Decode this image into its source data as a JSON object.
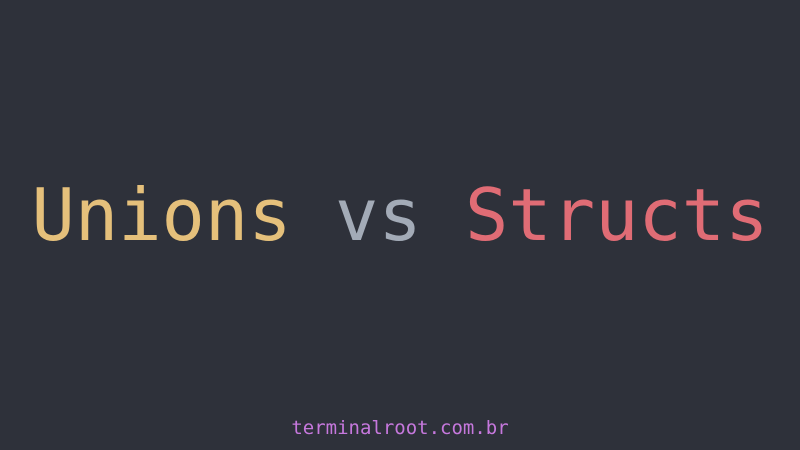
{
  "title": {
    "word1": "Unions",
    "word2": "vs",
    "word3": "Structs"
  },
  "footer": {
    "site": "terminalroot.com.br"
  },
  "colors": {
    "background": "#2e313a",
    "word1": "#e5c07b",
    "word2": "#a3abb7",
    "word3": "#e06c75",
    "footer": "#c678dd"
  }
}
